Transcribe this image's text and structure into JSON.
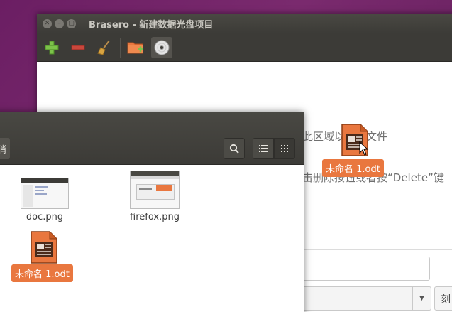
{
  "brasero": {
    "title": "Brasero - 新建数据光盘项目",
    "hint_line1": "此区域以添加文件",
    "hint_line2": "击删除按钮或者按“Delete”键",
    "burn_label": "刻"
  },
  "files": {
    "left_button_label": "消",
    "items": [
      {
        "name": "doc.png"
      },
      {
        "name": "firefox.png"
      },
      {
        "name": "未命名 1.odt"
      }
    ]
  },
  "drag": {
    "label": "未命名 1.odt"
  },
  "icons": {
    "add": "plus-icon",
    "remove": "minus-icon",
    "clean": "broom-icon",
    "add_folder": "folder-add-icon",
    "disc": "disc-icon",
    "search": "search-icon",
    "list": "list-view-icon",
    "grid": "grid-view-icon"
  },
  "colors": {
    "accent": "#e9773f",
    "titlebar": "#3c3b37",
    "desktop": "#6b1e63"
  }
}
